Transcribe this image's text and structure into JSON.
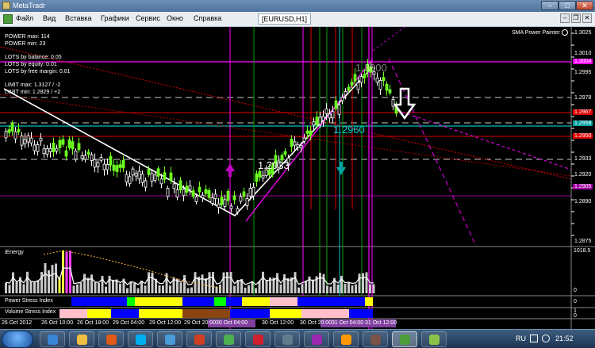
{
  "window": {
    "title": "MetaTradr",
    "minimize": "–",
    "maximize": "□",
    "close": "✕"
  },
  "menu": {
    "items": [
      "Файл",
      "Вид",
      "Вставка",
      "Графики",
      "Сервис",
      "Окно",
      "Справка"
    ],
    "document_tab": "[EURUSD,H1]",
    "mdi_minimize": "–",
    "mdi_restore": "❐",
    "mdi_close": "✕"
  },
  "chart": {
    "indicator_name": "SMA Power Painter",
    "info": {
      "power_max": "POWER max: 114",
      "power_min": "POWER min: 23",
      "lots_balance": "LOTS by balance: 0.05",
      "lots_equity": "LOTS by equity: 0.01",
      "lots_margin": "LOTS by free margin: 0.01",
      "limit_max": "LIMIT max: 1.3127 / -2",
      "limit_min": "LIMIT min: 1.2829 / +2"
    },
    "big_labels": [
      "1.2933",
      "1.2960",
      "1.3000"
    ],
    "price_labels": [
      "1.3025",
      "1.3010",
      "1.3004",
      "1.2995",
      "1.2978",
      "1.2967",
      "1.2958",
      "1.2950",
      "1.2933",
      "1.2920",
      "1.2905",
      "1.2890",
      "1.2875"
    ],
    "sub_windows": {
      "ienergy": {
        "name": "iEnergy",
        "scale": [
          "1018.5",
          "0"
        ]
      },
      "power_stress": {
        "name": "Power Stress Index",
        "scale": [
          "0"
        ]
      },
      "volume_stress": {
        "name": "Volume Stress Index",
        "scale": [
          "1",
          "0"
        ]
      }
    },
    "time_labels": [
      "26 Oct 2012",
      "26 Oct 10:00",
      "26 Oct 18:00",
      "29 Oct 04:00",
      "29 Oct 12:00",
      "29 Oct 20:00",
      "30 Oct 04:00",
      "30 Oct 12:00",
      "30 Oct 20:00",
      "31 Oct 04:00",
      "31 Oct 12:00"
    ],
    "colors": {
      "bull": "#6cff20",
      "bear": "#ffffff",
      "magenta": "#ff00ff",
      "red": "#e00000",
      "cyan": "#00c8c8",
      "green": "#00a000"
    }
  },
  "taskbar": {
    "apps": [
      "ie",
      "explorer",
      "media",
      "skype",
      "mail",
      "office",
      "chrome",
      "opera",
      "app1",
      "app2",
      "app3",
      "app4",
      "metatrader",
      "app5"
    ],
    "lang": "RU",
    "clock": "21:52"
  }
}
